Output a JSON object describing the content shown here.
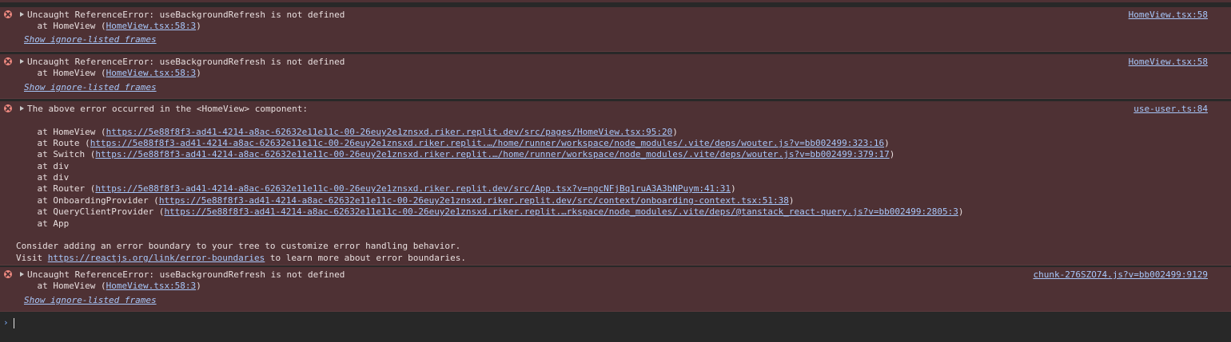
{
  "colors": {
    "error_bg": "#4e3134",
    "link": "#a8c7fa",
    "console_bg": "#282828",
    "error_icon": "#f28b82"
  },
  "messages": [
    {
      "title": "Uncaught ReferenceError: useBackgroundRefresh is not defined",
      "at_prefix": "    at HomeView (",
      "at_link": "HomeView.tsx:58:3",
      "at_suffix": ")",
      "ignore_link": "Show ignore-listed frames",
      "source": "HomeView.tsx:58"
    },
    {
      "title": "Uncaught ReferenceError: useBackgroundRefresh is not defined",
      "at_prefix": "    at HomeView (",
      "at_link": "HomeView.tsx:58:3",
      "at_suffix": ")",
      "ignore_link": "Show ignore-listed frames",
      "source": "HomeView.tsx:58"
    },
    {
      "title": "The above error occurred in the <HomeView> component:",
      "source": "use-user.ts:84",
      "stack": [
        {
          "prefix": "    at HomeView (",
          "link": "https://5e88f8f3-ad41-4214-a8ac-62632e11e11c-00-26euy2e1znsxd.riker.replit.dev/src/pages/HomeView.tsx:95:20",
          "suffix": ")"
        },
        {
          "prefix": "    at Route (",
          "link": "https://5e88f8f3-ad41-4214-a8ac-62632e11e11c-00-26euy2e1znsxd.riker.replit.…/home/runner/workspace/node_modules/.vite/deps/wouter.js?v=bb002499:323:16",
          "suffix": ")"
        },
        {
          "prefix": "    at Switch (",
          "link": "https://5e88f8f3-ad41-4214-a8ac-62632e11e11c-00-26euy2e1znsxd.riker.replit.…/home/runner/workspace/node_modules/.vite/deps/wouter.js?v=bb002499:379:17",
          "suffix": ")"
        },
        {
          "prefix": "    at div",
          "link": "",
          "suffix": ""
        },
        {
          "prefix": "    at div",
          "link": "",
          "suffix": ""
        },
        {
          "prefix": "    at Router (",
          "link": "https://5e88f8f3-ad41-4214-a8ac-62632e11e11c-00-26euy2e1znsxd.riker.replit.dev/src/App.tsx?v=ngcNFjBq1ruA3A3bNPuym:41:31",
          "suffix": ")"
        },
        {
          "prefix": "    at OnboardingProvider (",
          "link": "https://5e88f8f3-ad41-4214-a8ac-62632e11e11c-00-26euy2e1znsxd.riker.replit.dev/src/context/onboarding-context.tsx:51:38",
          "suffix": ")"
        },
        {
          "prefix": "    at QueryClientProvider (",
          "link": "https://5e88f8f3-ad41-4214-a8ac-62632e11e11c-00-26euy2e1znsxd.riker.replit.…rkspace/node_modules/.vite/deps/@tanstack_react-query.js?v=bb002499:2805:3",
          "suffix": ")"
        },
        {
          "prefix": "    at App",
          "link": "",
          "suffix": ""
        }
      ],
      "advice_line1": "Consider adding an error boundary to your tree to customize error handling behavior.",
      "advice_line2_prefix": "Visit ",
      "advice_line2_link": "https://reactjs.org/link/error-boundaries",
      "advice_line2_suffix": " to learn more about error boundaries."
    },
    {
      "title": "Uncaught ReferenceError: useBackgroundRefresh is not defined",
      "at_prefix": "    at HomeView (",
      "at_link": "HomeView.tsx:58:3",
      "at_suffix": ")",
      "ignore_link": "Show ignore-listed frames",
      "source": "chunk-276SZO74.js?v=bb002499:9129"
    }
  ]
}
